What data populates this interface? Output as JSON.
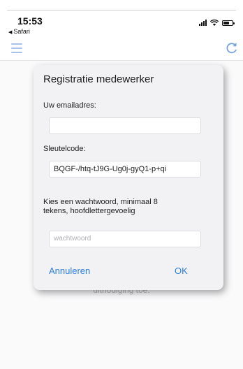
{
  "status_bar": {
    "time": "15:53",
    "back_app": "Safari",
    "icons": [
      "signal-icon",
      "wifi-icon",
      "battery-icon"
    ]
  },
  "toolbar": {
    "icons": [
      "menu-icon",
      "refresh-icon"
    ],
    "accent": "#3a7bd5"
  },
  "background": {
    "partial_text": "uitnodiging toe."
  },
  "dialog": {
    "title": "Registratie medewerker",
    "email_label": "Uw emailadres:",
    "email_value": "",
    "key_label": "Sleutelcode:",
    "key_value": "BQGF-/htq-tJ9G-Ug0j-gyQ1-p+qi",
    "password_label_line1": "Kies een wachtwoord, minimaal 8",
    "password_label_line2": "tekens, hoofdlettergevoelig",
    "password_placeholder": "wachtwoord",
    "cancel_label": "Annuleren",
    "ok_label": "OK",
    "button_color": "#2e7de0"
  }
}
